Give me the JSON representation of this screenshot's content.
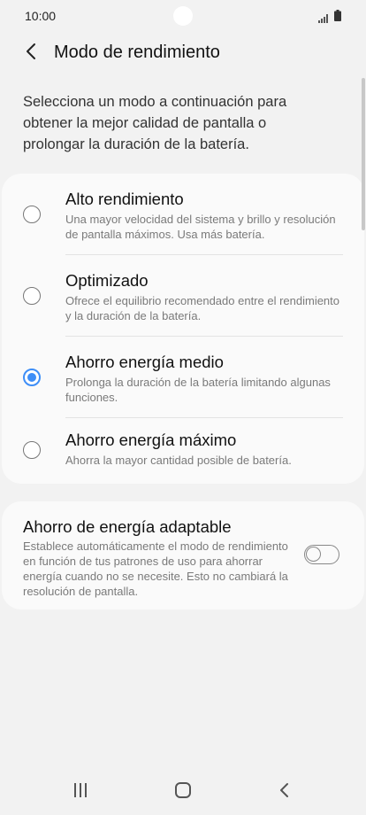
{
  "status_bar": {
    "time": "10:00",
    "signal_icon": "signal-icon",
    "battery_icon": "battery-icon"
  },
  "header": {
    "back_icon": "chevron-left-icon",
    "title": "Modo de rendimiento"
  },
  "intro_text": "Selecciona un modo a continuación para obtener la mejor calidad de pantalla o prolongar la duración de la batería.",
  "modes": [
    {
      "title": "Alto rendimiento",
      "description": "Una mayor velocidad del sistema y brillo y resolución de pantalla máximos. Usa más batería.",
      "selected": false
    },
    {
      "title": "Optimizado",
      "description": "Ofrece el equilibrio recomendado entre el rendimiento y la duración de la batería.",
      "selected": false
    },
    {
      "title": "Ahorro energía medio",
      "description": "Prolonga la duración de la batería limitando algunas funciones.",
      "selected": true
    },
    {
      "title": "Ahorro energía máximo",
      "description": "Ahorra la mayor cantidad posible de batería.",
      "selected": false
    }
  ],
  "adaptive": {
    "title": "Ahorro de energía adaptable",
    "description": "Establece automáticamente el modo de rendimiento en función de tus patrones de uso para ahorrar energía cuando no se necesite. Esto no cambiará la resolución de pantalla.",
    "toggle_on": false
  },
  "nav_bar": {
    "recents_icon": "recents-icon",
    "home_icon": "home-icon",
    "back_icon": "back-chevron-icon"
  },
  "colors": {
    "accent": "#3e8ef7",
    "background": "#f2f2f2",
    "card": "#fafafa"
  }
}
